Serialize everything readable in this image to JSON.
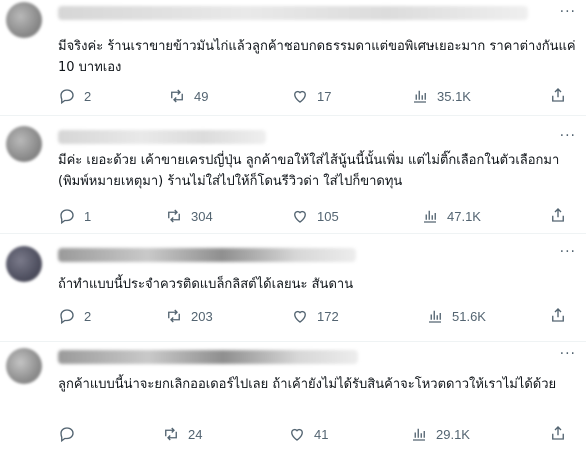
{
  "posts": [
    {
      "text": "มีจริงค่ะ ร้านเราขายข้าวมันไก่แล้วลูกค้าชอบกดธรรมดาแต่ขอพิเศษเยอะมาก ราคาต่างกันแค่ 10 บาทเอง",
      "replies": "2",
      "reposts": "49",
      "likes": "17",
      "views": "35.1K"
    },
    {
      "text": "มีค่ะ เยอะด้วย เค้าขายเครปญี่ปุ่น ลูกค้าขอให้ใส่ไส้นู้นนี้นั้นเพิ่ม แต่ไม่ติ๊กเลือกในตัวเลือกมา (พิมพ์หมายเหตุมา) ร้านไม่ใส่ไปให้ก็โดนรีวิวด่า ใส่ไปก็ขาดทุน",
      "replies": "1",
      "reposts": "304",
      "likes": "105",
      "views": "47.1K"
    },
    {
      "text": "ถ้าทำแบบนี้ประจำควรติดแบล็กลิสต์ได้เลยนะ สันดาน",
      "replies": "2",
      "reposts": "203",
      "likes": "172",
      "views": "51.6K"
    },
    {
      "text": "ลูกค้าแบบนี้น่าจะยกเลิกออเดอร์ไปเลย ถ้าเค้ายังไม่ได้รับสินค้าจะโหวตดาวให้เราไม่ได้ด้วย",
      "replies": "0",
      "reposts": "24",
      "likes": "41",
      "views": "29.1K"
    }
  ],
  "more_glyph": "···",
  "icons": [
    "reply-icon",
    "repost-icon",
    "like-icon",
    "views-icon",
    "share-icon"
  ]
}
